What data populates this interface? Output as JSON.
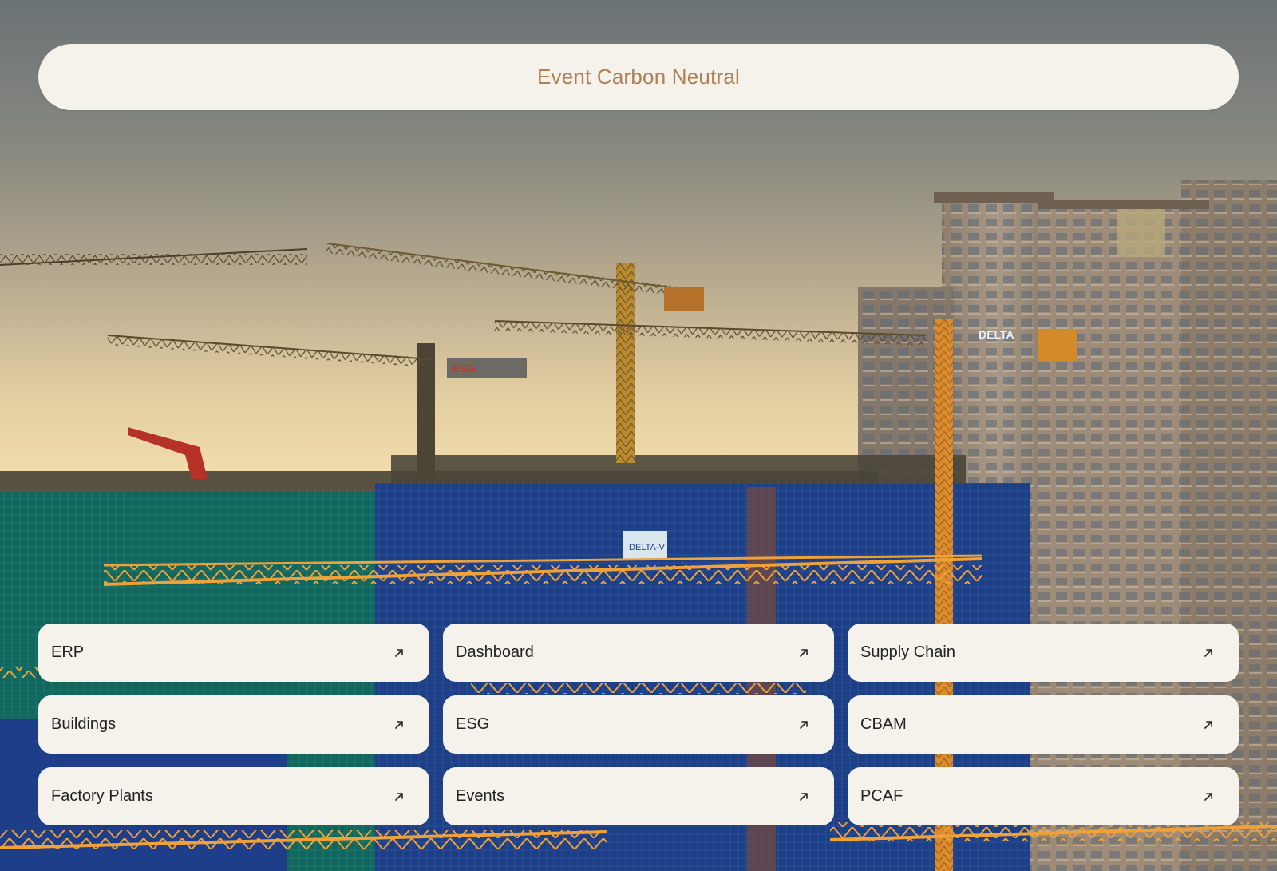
{
  "header": {
    "title": "Event Carbon Neutral"
  },
  "links": [
    {
      "label": "ERP",
      "icon": "arrow-up-right-icon"
    },
    {
      "label": "Dashboard",
      "icon": "arrow-up-right-icon"
    },
    {
      "label": "Supply Chain",
      "icon": "arrow-up-right-icon"
    },
    {
      "label": "Buildings",
      "icon": "arrow-up-right-icon"
    },
    {
      "label": "ESG",
      "icon": "arrow-up-right-icon"
    },
    {
      "label": "CBAM",
      "icon": "arrow-up-right-icon"
    },
    {
      "label": "Factory Plants",
      "icon": "arrow-up-right-icon"
    },
    {
      "label": "Events",
      "icon": "arrow-up-right-icon"
    },
    {
      "label": "PCAF",
      "icon": "arrow-up-right-icon"
    }
  ],
  "background": {
    "image": "construction-site-cranes-at-sunset",
    "signs": [
      "DELTA",
      "DELTA-V",
      "ESG"
    ]
  },
  "colors": {
    "card_background": "#f5f2ec",
    "title_color": "#b07f55",
    "label_color": "#222222"
  }
}
